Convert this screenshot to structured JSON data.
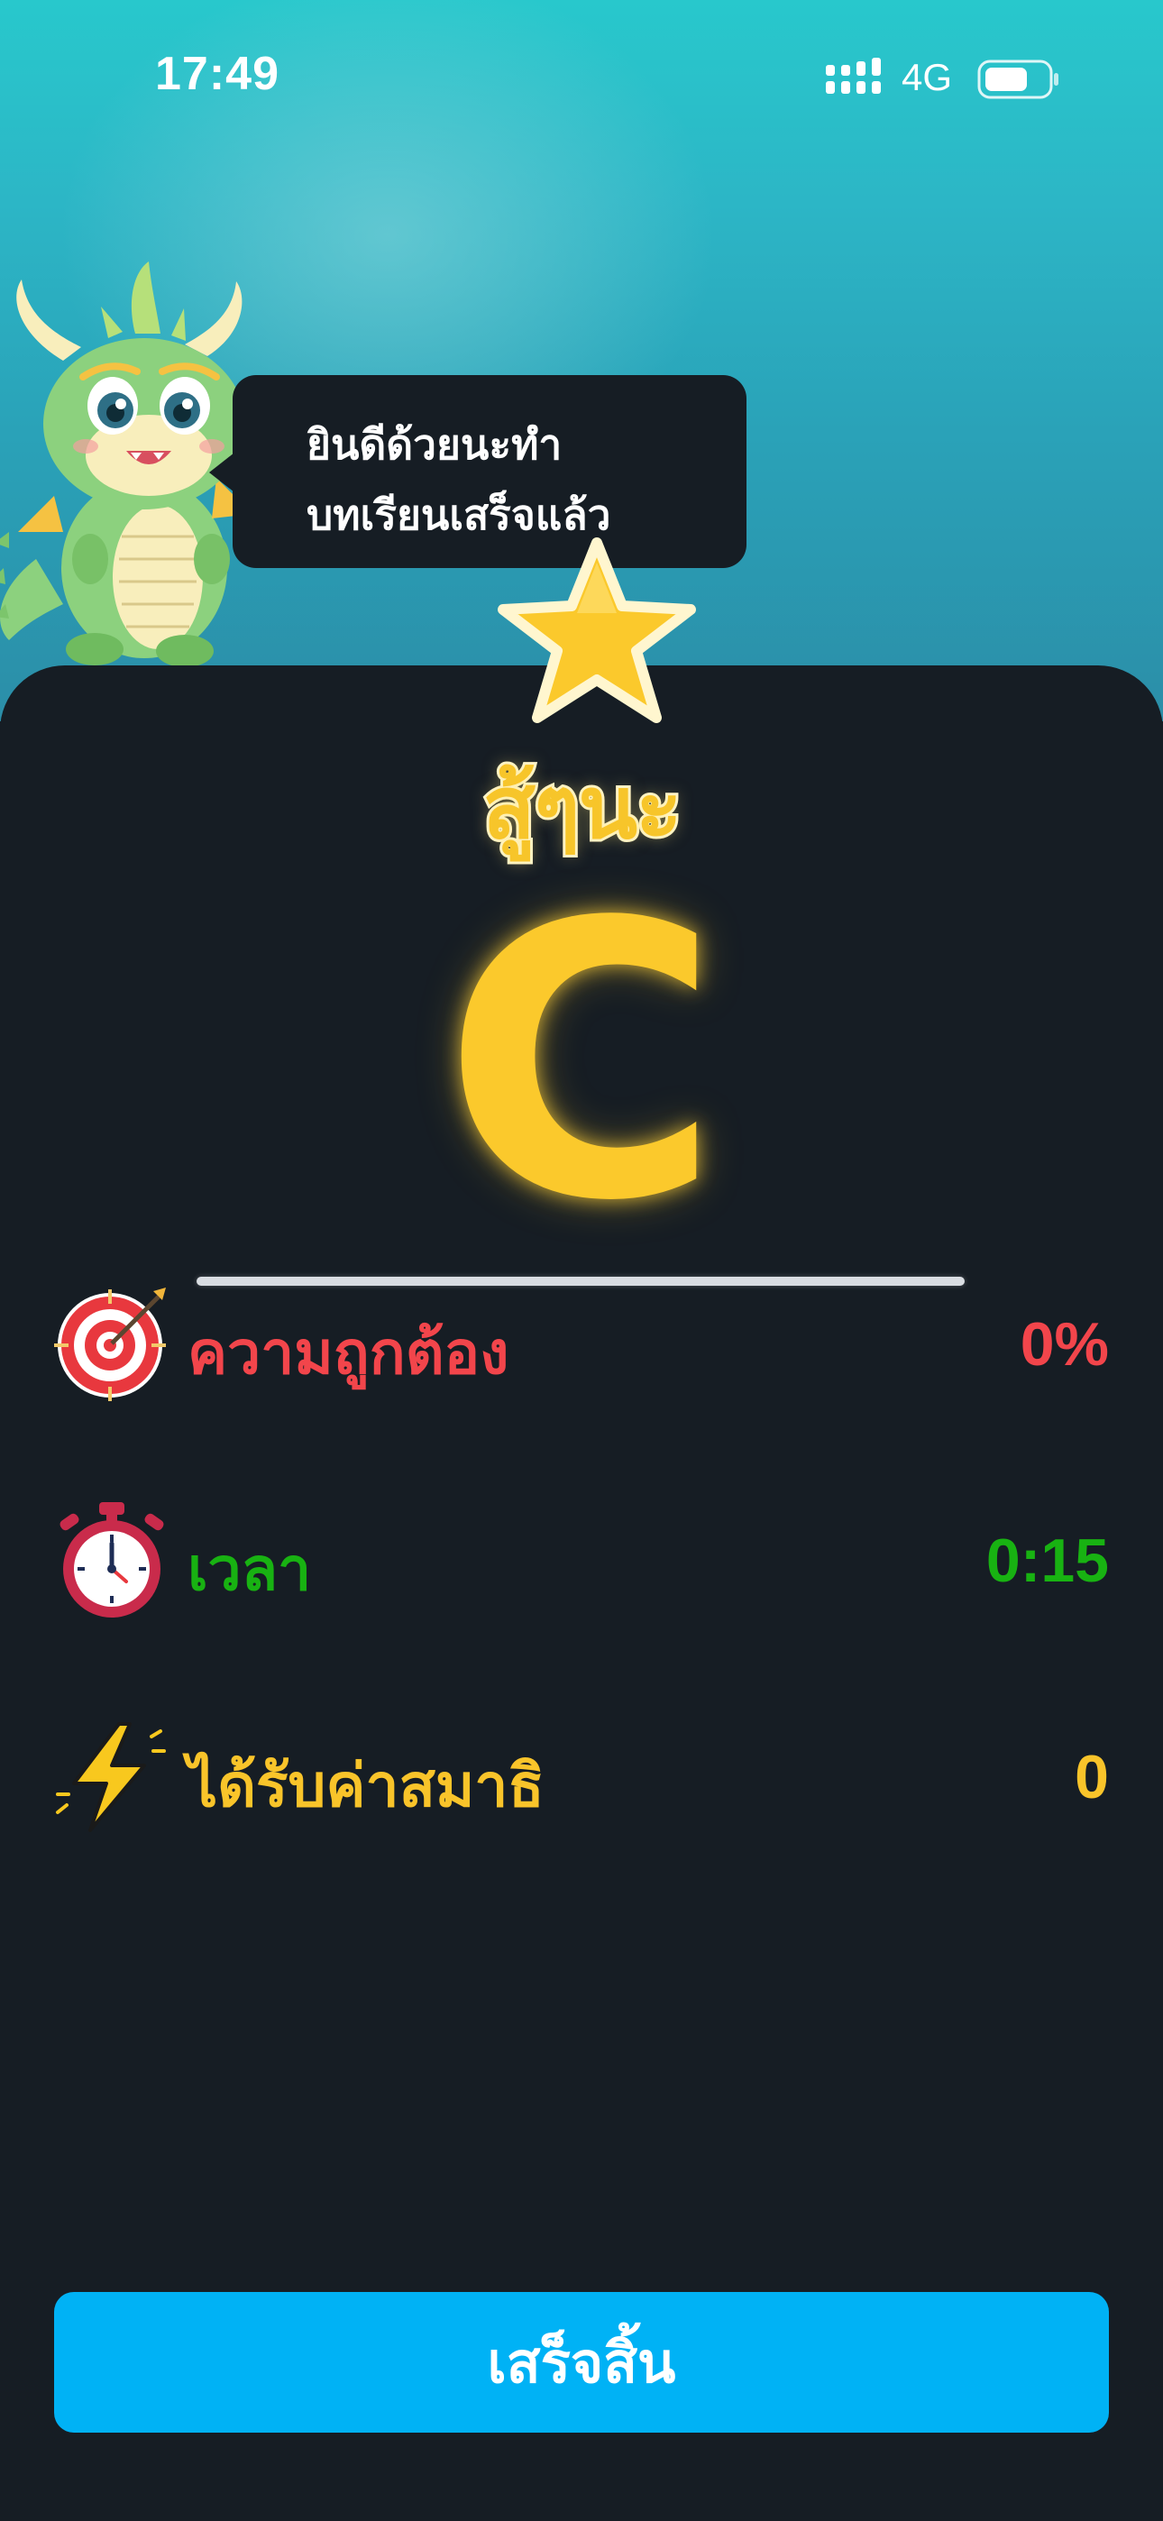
{
  "status_bar": {
    "time": "17:49",
    "network": "4G",
    "signal_icon": "signal-bars-icon",
    "battery_icon": "battery-icon",
    "battery_level": 0.7
  },
  "mascot": {
    "icon": "green-dragon-mascot"
  },
  "bubble": {
    "line1": "ยินดีด้วยนะทำ",
    "line2": "บทเรียนเสร็จแล้ว"
  },
  "result": {
    "badge_icon": "star-icon",
    "rating_word": "สู้ๆนะ",
    "grade": "C",
    "progress": 0
  },
  "stats": [
    {
      "icon": "target-icon",
      "label": "ความถูกต้อง",
      "value": "0%",
      "color": "#f2454b"
    },
    {
      "icon": "stopwatch-icon",
      "label": "เวลา",
      "value": "0:15",
      "color": "#18b212"
    },
    {
      "icon": "lightning-icon",
      "label": "ได้รับค่าสมาธิ",
      "value": "0",
      "color": "#f9c42a"
    }
  ],
  "finish_button": {
    "label": "เสร็จสิ้น",
    "color": "#00b2f5"
  },
  "colors": {
    "background_top": "#2ab8c8",
    "card": "#161d24",
    "accent_yellow": "#fbc92c"
  }
}
